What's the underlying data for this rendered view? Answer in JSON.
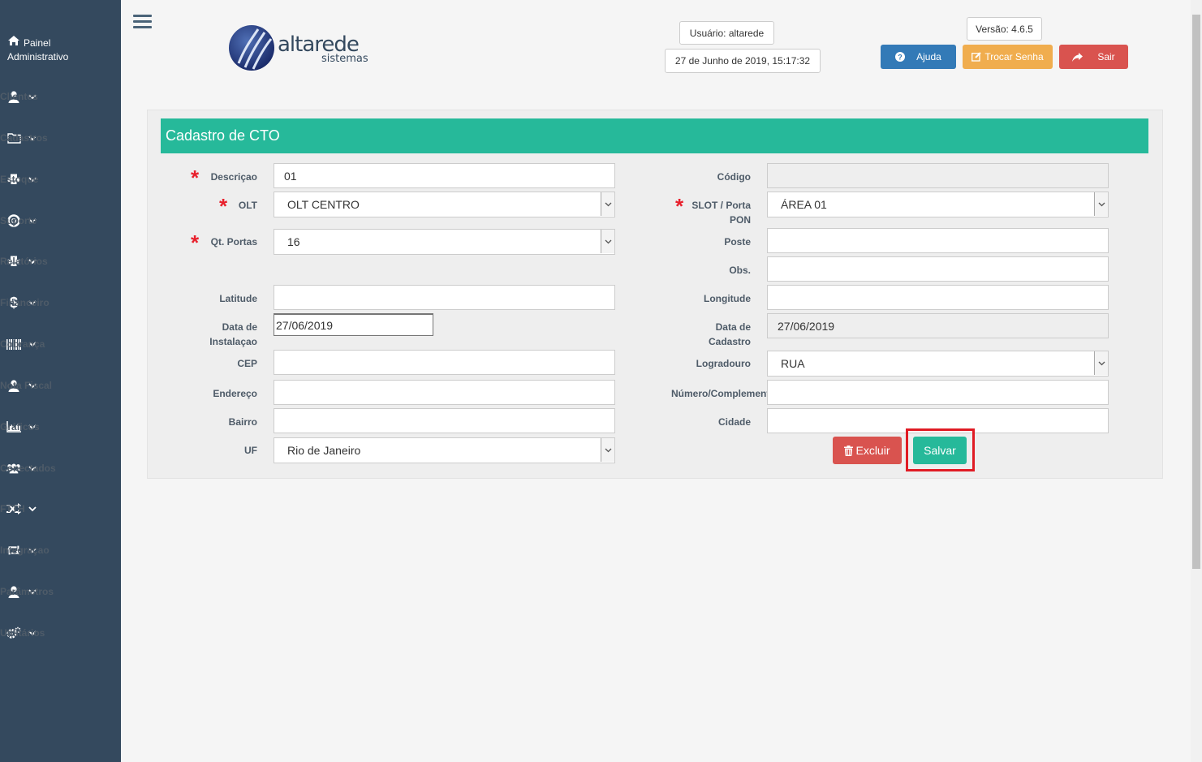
{
  "sidebar": {
    "top_label": "Painel Administrativo",
    "items": [
      {
        "label": "Clientes",
        "icon": "user-icon"
      },
      {
        "label": "Cadastros",
        "icon": "folder-icon"
      },
      {
        "label": "Estoque",
        "icon": "printer-icon"
      },
      {
        "label": "Suporte",
        "icon": "lifebuoy-icon"
      },
      {
        "label": "Relatórios",
        "icon": "printer-icon"
      },
      {
        "label": "Financeiro",
        "icon": "dollar-icon"
      },
      {
        "label": "Cobrança",
        "icon": "barcode-icon"
      },
      {
        "label": "Nota Fiscal",
        "icon": "user-icon"
      },
      {
        "label": "Gráficos",
        "icon": "area-chart-icon"
      },
      {
        "label": "Conectados",
        "icon": "users-icon"
      },
      {
        "label": "FTTH",
        "icon": "shuffle-icon"
      },
      {
        "label": "Integraçao",
        "icon": "retweet-icon"
      },
      {
        "label": "Parâmetros",
        "icon": "user-icon"
      },
      {
        "label": "Utilitários",
        "icon": "cogs-icon"
      }
    ]
  },
  "header": {
    "logo_main": "altarede",
    "logo_sub": "sistemas",
    "user": "Usuário: altarede",
    "datetime": "27 de Junho de 2019, 15:17:32",
    "version": "Versão: 4.6.5",
    "help_label": "Ajuda",
    "change_password_label": "Trocar Senha",
    "logout_label": "Sair"
  },
  "form": {
    "title": "Cadastro de CTO",
    "labels": {
      "descricao": "Descriçao",
      "olt": "OLT",
      "qt_portas": "Qt. Portas",
      "latitude": "Latitude",
      "data_instalacao_1": "Data de",
      "data_instalacao_2": "Instalaçao",
      "cep": "CEP",
      "endereco": "Endereço",
      "bairro": "Bairro",
      "uf": "UF",
      "codigo": "Código",
      "slot_1": "SLOT / Porta",
      "slot_2": "PON",
      "poste": "Poste",
      "obs": "Obs.",
      "longitude": "Longitude",
      "data_cadastro_1": "Data de",
      "data_cadastro_2": "Cadastro",
      "logradouro": "Logradouro",
      "numero": "Número/Complemento",
      "cidade": "Cidade"
    },
    "values": {
      "descricao": "01",
      "olt": "OLT CENTRO",
      "qt_portas": "16",
      "latitude": "",
      "data_instalacao": "27/06/2019",
      "cep": "",
      "endereco": "",
      "bairro": "",
      "uf": "Rio de Janeiro",
      "codigo": "",
      "slot": "ÁREA 01",
      "poste": "",
      "obs": "",
      "longitude": "",
      "data_cadastro": "27/06/2019",
      "logradouro": "RUA",
      "numero": "",
      "cidade": ""
    },
    "delete_label": "Excluir",
    "save_label": "Salvar"
  },
  "colors": {
    "sidebar": "#34495e",
    "primary": "#26b99a",
    "help": "#337ab7",
    "warning": "#f0ad4e",
    "danger": "#d9534f",
    "required": "#e8202c",
    "highlight": "#e01b24"
  }
}
